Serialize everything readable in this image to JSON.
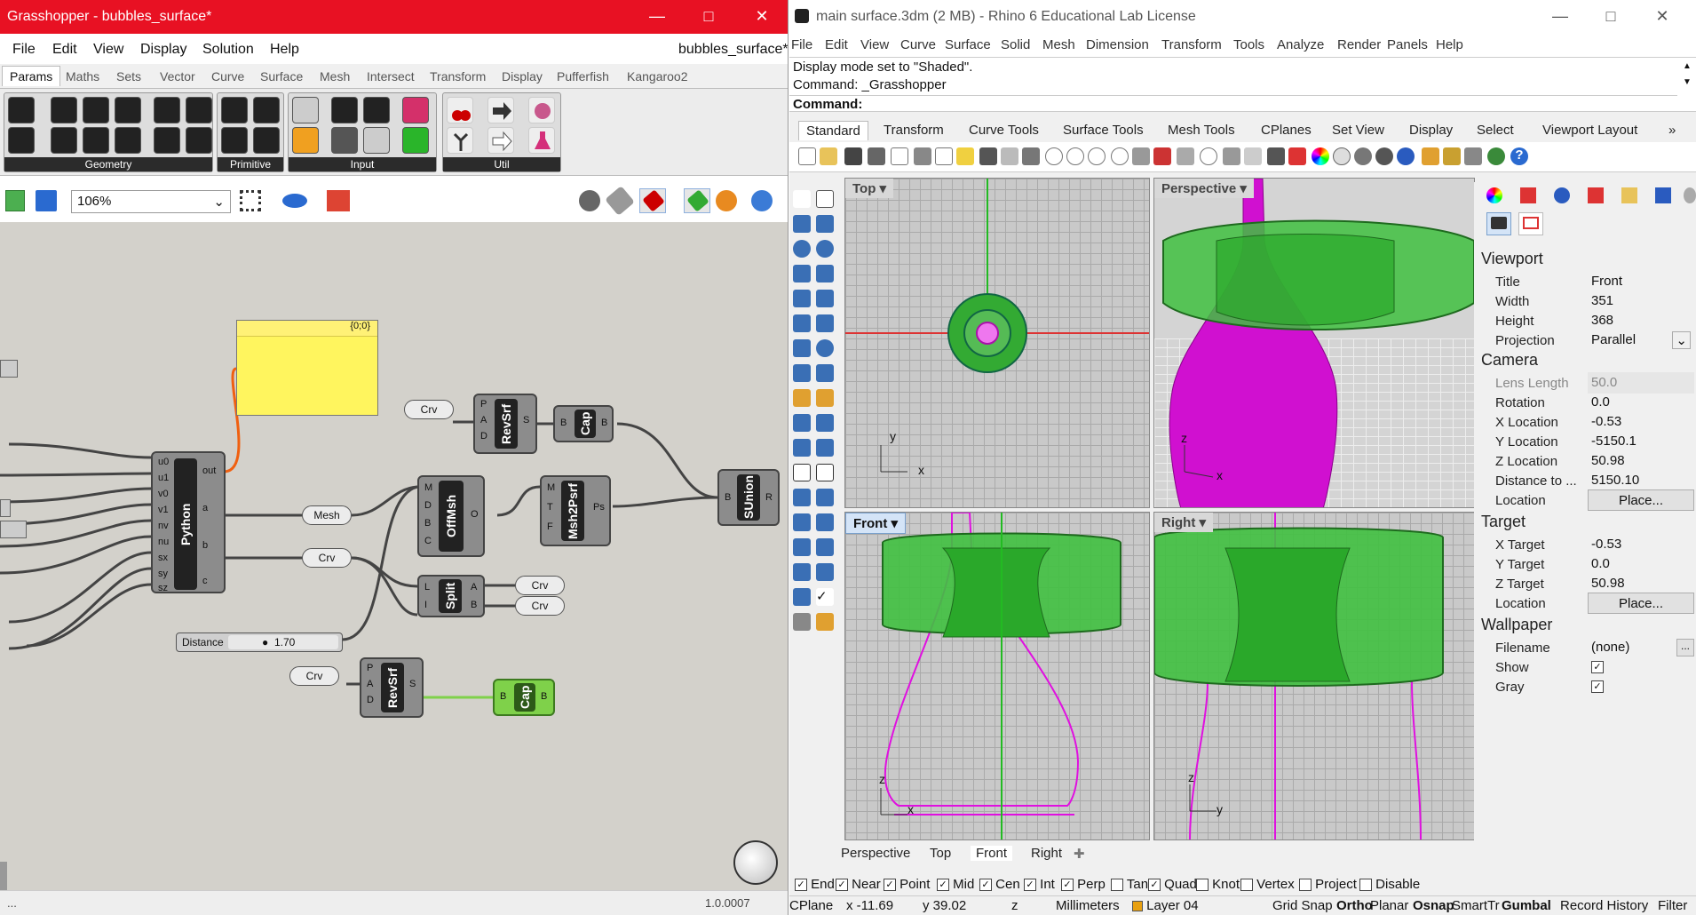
{
  "grasshopper": {
    "title": "Grasshopper - bubbles_surface*",
    "doc_name": "bubbles_surface*",
    "menu": [
      "File",
      "Edit",
      "View",
      "Display",
      "Solution",
      "Help"
    ],
    "tabs": [
      "Params",
      "Maths",
      "Sets",
      "Vector",
      "Curve",
      "Surface",
      "Mesh",
      "Intersect",
      "Transform",
      "Display",
      "Pufferfish",
      "Kangaroo2"
    ],
    "ribbon_groups": [
      "Geometry",
      "Primitive",
      "Input",
      "Util"
    ],
    "zoom": "106%",
    "panel_text": "{0;0}",
    "python": {
      "label": "Python",
      "inputs": [
        "u0",
        "u1",
        "v0",
        "v1",
        "nv",
        "nu",
        "sx",
        "sy",
        "sz"
      ],
      "outputs": [
        "out",
        "a",
        "b",
        "c"
      ]
    },
    "slider": {
      "label": "Distance",
      "value": "1.70"
    },
    "components": {
      "revsrf": "RevSrf",
      "cap": "Cap",
      "offmsh": "OffMsh",
      "msh2psrf": "Msh2Psrf",
      "sunion": "SUnion",
      "split": "Split"
    },
    "params": {
      "crv": "Crv",
      "mesh": "Mesh"
    },
    "pins": {
      "P": "P",
      "A": "A",
      "D": "D",
      "S": "S",
      "B": "B",
      "M": "M",
      "O": "O",
      "T": "T",
      "F": "F",
      "Ps": "Ps",
      "R": "R",
      "L": "L",
      "I": "I"
    },
    "version": "1.0.0007",
    "status_left": "..."
  },
  "rhino": {
    "title": "main surface.3dm (2 MB) - Rhino 6 Educational Lab License",
    "menu": [
      "File",
      "Edit",
      "View",
      "Curve",
      "Surface",
      "Solid",
      "Mesh",
      "Dimension",
      "Transform",
      "Tools",
      "Analyze",
      "Render",
      "Panels",
      "Help"
    ],
    "history": [
      "Display mode set to \"Shaded\".",
      "Command: _Grasshopper"
    ],
    "command_label": "Command:",
    "tabs": [
      "Standard",
      "Transform",
      "Curve Tools",
      "Surface Tools",
      "Mesh Tools",
      "CPlanes",
      "Set View",
      "Display",
      "Select",
      "Viewport Layout"
    ],
    "viewports": {
      "top": "Top",
      "perspective": "Perspective",
      "front": "Front",
      "right": "Right"
    },
    "axes": {
      "x": "x",
      "y": "y",
      "z": "z"
    },
    "vp_tabs": [
      "Perspective",
      "Top",
      "Front",
      "Right"
    ],
    "panel": {
      "viewport_title": "Viewport",
      "title_label": "Title",
      "title_value": "Front",
      "width_label": "Width",
      "width_value": "351",
      "height_label": "Height",
      "height_value": "368",
      "projection_label": "Projection",
      "projection_value": "Parallel",
      "camera_title": "Camera",
      "lens_label": "Lens Length",
      "lens_value": "50.0",
      "rotation_label": "Rotation",
      "rotation_value": "0.0",
      "xloc_label": "X Location",
      "xloc_value": "-0.53",
      "yloc_label": "Y Location",
      "yloc_value": "-5150.1",
      "zloc_label": "Z Location",
      "zloc_value": "50.98",
      "dist_label": "Distance to ...",
      "dist_value": "5150.10",
      "loc_label": "Location",
      "place_btn": "Place...",
      "target_title": "Target",
      "xt_label": "X Target",
      "xt_value": "-0.53",
      "yt_label": "Y Target",
      "yt_value": "0.0",
      "zt_label": "Z Target",
      "zt_value": "50.98",
      "wallpaper_title": "Wallpaper",
      "filename_label": "Filename",
      "filename_value": "(none)",
      "browse": "...",
      "show_label": "Show",
      "gray_label": "Gray"
    },
    "osnaps": [
      {
        "label": "End",
        "on": true
      },
      {
        "label": "Near",
        "on": true
      },
      {
        "label": "Point",
        "on": true
      },
      {
        "label": "Mid",
        "on": true
      },
      {
        "label": "Cen",
        "on": true
      },
      {
        "label": "Int",
        "on": true
      },
      {
        "label": "Perp",
        "on": true
      },
      {
        "label": "Tan",
        "on": false
      },
      {
        "label": "Quad",
        "on": true
      },
      {
        "label": "Knot",
        "on": false
      },
      {
        "label": "Vertex",
        "on": false
      },
      {
        "label": "Project",
        "on": false
      },
      {
        "label": "Disable",
        "on": false
      }
    ],
    "status": {
      "cplane": "CPlane",
      "x": "x -11.69",
      "y": "y 39.02",
      "z": "z",
      "units": "Millimeters",
      "layer": "Layer 04",
      "toggles": [
        "Grid Snap",
        "Ortho",
        "Planar",
        "Osnap",
        "SmartTrack",
        "Gumbal",
        "Record History",
        "Filter"
      ]
    }
  }
}
